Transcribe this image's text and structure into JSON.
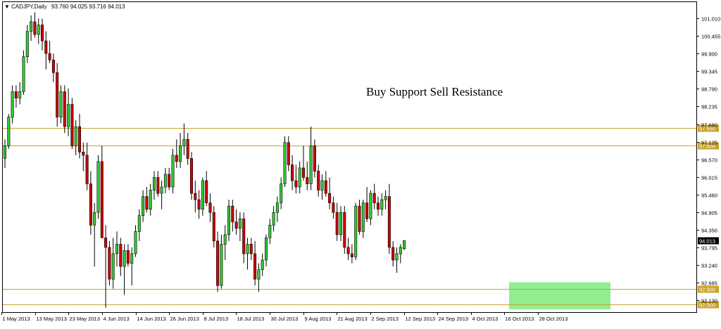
{
  "header": {
    "arrow_icon": "triangle-down-icon",
    "symbol": "CADJPY,Daily",
    "ohlc": "93.760 94.025 93.716 94.013"
  },
  "chart_data": {
    "type": "candlestick",
    "symbol": "CADJPY,Daily",
    "annotation": "Buy Support Sell Resistance",
    "ylim": [
      91.7,
      101.4
    ],
    "y_ticks": [
      "101.010",
      "100.455",
      "99.900",
      "99.345",
      "98.790",
      "98.235",
      "97.680",
      "97.125",
      "96.570",
      "96.015",
      "95.460",
      "94.905",
      "94.350",
      "93.795",
      "93.240",
      "92.685",
      "92.130"
    ],
    "x_ticks": [
      "1 May 2013",
      "13 May 2013",
      "23 May 2013",
      "4 Jun 2013",
      "14 Jun 2013",
      "26 Jun 2013",
      "8 Jul 2013",
      "18 Jul 2013",
      "30 Jul 2013",
      "9 Aug 2013",
      "21 Aug 2013",
      "2 Sep 2013",
      "12 Sep 2013",
      "24 Sep 2013",
      "4 Oct 2013",
      "16 Oct 2013",
      "28 Oct 2013"
    ],
    "current_price": "94.013",
    "horizontal_lines": [
      {
        "label": "97.550",
        "value": 97.55
      },
      {
        "label": "97.000",
        "value": 97.0
      },
      {
        "label": "92.500",
        "value": 92.5
      },
      {
        "label": "92.000",
        "value": 92.0
      }
    ],
    "zone": {
      "price_low": 91.85,
      "price_high": 92.7,
      "color": "#90ee90",
      "start_date": "15 Oct 2013",
      "end_date": "Nov 2013"
    },
    "colors": {
      "up": "#33cc33",
      "down": "#cc0000",
      "wick": "#000000",
      "level_line": "#c9a227",
      "grid_label": "#000000"
    },
    "candles": [
      {
        "o": 96.6,
        "h": 97.2,
        "l": 96.3,
        "c": 97.0
      },
      {
        "o": 97.0,
        "h": 98.0,
        "l": 96.9,
        "c": 97.9
      },
      {
        "o": 97.9,
        "h": 98.9,
        "l": 97.7,
        "c": 98.7
      },
      {
        "o": 98.7,
        "h": 98.9,
        "l": 98.2,
        "c": 98.5
      },
      {
        "o": 98.5,
        "h": 99.0,
        "l": 98.3,
        "c": 98.7
      },
      {
        "o": 98.7,
        "h": 100.0,
        "l": 98.6,
        "c": 99.8
      },
      {
        "o": 99.8,
        "h": 100.8,
        "l": 99.6,
        "c": 100.6
      },
      {
        "o": 100.6,
        "h": 101.1,
        "l": 100.3,
        "c": 100.9
      },
      {
        "o": 100.9,
        "h": 101.2,
        "l": 100.4,
        "c": 100.5
      },
      {
        "o": 100.5,
        "h": 101.0,
        "l": 100.2,
        "c": 100.8
      },
      {
        "o": 100.8,
        "h": 101.0,
        "l": 100.0,
        "c": 100.3
      },
      {
        "o": 100.3,
        "h": 100.6,
        "l": 99.4,
        "c": 99.9
      },
      {
        "o": 99.9,
        "h": 100.3,
        "l": 99.6,
        "c": 99.7
      },
      {
        "o": 99.7,
        "h": 99.9,
        "l": 99.0,
        "c": 99.3
      },
      {
        "o": 99.3,
        "h": 99.6,
        "l": 97.6,
        "c": 97.9
      },
      {
        "o": 97.9,
        "h": 98.9,
        "l": 97.7,
        "c": 98.7
      },
      {
        "o": 98.7,
        "h": 98.9,
        "l": 97.4,
        "c": 97.6
      },
      {
        "o": 97.6,
        "h": 98.8,
        "l": 97.3,
        "c": 98.3
      },
      {
        "o": 98.3,
        "h": 98.5,
        "l": 96.9,
        "c": 97.0
      },
      {
        "o": 97.0,
        "h": 97.8,
        "l": 96.7,
        "c": 97.6
      },
      {
        "o": 97.6,
        "h": 98.0,
        "l": 96.6,
        "c": 96.8
      },
      {
        "o": 96.8,
        "h": 97.1,
        "l": 96.2,
        "c": 96.7
      },
      {
        "o": 96.7,
        "h": 97.1,
        "l": 95.6,
        "c": 95.8
      },
      {
        "o": 95.8,
        "h": 96.2,
        "l": 94.2,
        "c": 94.5
      },
      {
        "o": 94.5,
        "h": 95.2,
        "l": 93.2,
        "c": 94.9
      },
      {
        "o": 94.9,
        "h": 96.7,
        "l": 94.7,
        "c": 96.5
      },
      {
        "o": 96.5,
        "h": 97.0,
        "l": 95.0,
        "c": 94.1
      },
      {
        "o": 94.1,
        "h": 94.5,
        "l": 91.9,
        "c": 93.8
      },
      {
        "o": 93.8,
        "h": 94.0,
        "l": 92.6,
        "c": 92.8
      },
      {
        "o": 92.8,
        "h": 94.1,
        "l": 92.5,
        "c": 93.6
      },
      {
        "o": 93.6,
        "h": 94.3,
        "l": 93.2,
        "c": 93.9
      },
      {
        "o": 93.9,
        "h": 94.1,
        "l": 92.9,
        "c": 93.2
      },
      {
        "o": 93.2,
        "h": 93.9,
        "l": 92.3,
        "c": 93.7
      },
      {
        "o": 93.7,
        "h": 93.9,
        "l": 93.2,
        "c": 93.3
      },
      {
        "o": 93.3,
        "h": 93.8,
        "l": 92.6,
        "c": 93.6
      },
      {
        "o": 93.6,
        "h": 94.5,
        "l": 93.5,
        "c": 94.3
      },
      {
        "o": 94.3,
        "h": 95.0,
        "l": 94.0,
        "c": 94.8
      },
      {
        "o": 94.8,
        "h": 95.6,
        "l": 94.6,
        "c": 95.4
      },
      {
        "o": 95.4,
        "h": 95.7,
        "l": 94.9,
        "c": 95.0
      },
      {
        "o": 95.0,
        "h": 95.8,
        "l": 94.8,
        "c": 95.6
      },
      {
        "o": 95.6,
        "h": 96.2,
        "l": 95.3,
        "c": 96.0
      },
      {
        "o": 96.0,
        "h": 96.2,
        "l": 95.4,
        "c": 95.5
      },
      {
        "o": 95.5,
        "h": 95.9,
        "l": 95.0,
        "c": 95.7
      },
      {
        "o": 95.7,
        "h": 96.3,
        "l": 95.5,
        "c": 96.1
      },
      {
        "o": 96.1,
        "h": 96.3,
        "l": 95.6,
        "c": 95.7
      },
      {
        "o": 95.7,
        "h": 96.9,
        "l": 95.5,
        "c": 96.7
      },
      {
        "o": 96.7,
        "h": 97.2,
        "l": 96.3,
        "c": 96.5
      },
      {
        "o": 96.5,
        "h": 97.4,
        "l": 96.3,
        "c": 97.0
      },
      {
        "o": 97.0,
        "h": 97.7,
        "l": 96.7,
        "c": 97.2
      },
      {
        "o": 97.2,
        "h": 97.4,
        "l": 96.4,
        "c": 96.6
      },
      {
        "o": 96.6,
        "h": 96.8,
        "l": 95.3,
        "c": 95.5
      },
      {
        "o": 95.5,
        "h": 95.9,
        "l": 94.9,
        "c": 95.3
      },
      {
        "o": 95.3,
        "h": 95.6,
        "l": 94.7,
        "c": 95.0
      },
      {
        "o": 95.0,
        "h": 96.0,
        "l": 94.8,
        "c": 95.9
      },
      {
        "o": 95.9,
        "h": 96.2,
        "l": 95.1,
        "c": 95.2
      },
      {
        "o": 95.2,
        "h": 95.5,
        "l": 94.6,
        "c": 94.9
      },
      {
        "o": 94.9,
        "h": 95.1,
        "l": 93.8,
        "c": 94.0
      },
      {
        "o": 94.0,
        "h": 94.3,
        "l": 92.4,
        "c": 92.6
      },
      {
        "o": 92.6,
        "h": 94.2,
        "l": 92.5,
        "c": 93.9
      },
      {
        "o": 93.9,
        "h": 94.5,
        "l": 93.4,
        "c": 94.2
      },
      {
        "o": 94.2,
        "h": 95.3,
        "l": 94.0,
        "c": 95.1
      },
      {
        "o": 95.1,
        "h": 95.3,
        "l": 94.3,
        "c": 94.6
      },
      {
        "o": 94.6,
        "h": 95.0,
        "l": 94.2,
        "c": 94.4
      },
      {
        "o": 94.4,
        "h": 94.9,
        "l": 94.0,
        "c": 94.7
      },
      {
        "o": 94.7,
        "h": 94.9,
        "l": 93.3,
        "c": 93.6
      },
      {
        "o": 93.6,
        "h": 94.1,
        "l": 93.1,
        "c": 93.9
      },
      {
        "o": 93.9,
        "h": 94.1,
        "l": 93.4,
        "c": 93.6
      },
      {
        "o": 93.6,
        "h": 94.0,
        "l": 92.6,
        "c": 92.8
      },
      {
        "o": 92.8,
        "h": 93.3,
        "l": 92.4,
        "c": 93.1
      },
      {
        "o": 93.1,
        "h": 93.6,
        "l": 92.9,
        "c": 93.4
      },
      {
        "o": 93.4,
        "h": 94.2,
        "l": 93.2,
        "c": 94.1
      },
      {
        "o": 94.1,
        "h": 94.7,
        "l": 93.9,
        "c": 94.5
      },
      {
        "o": 94.5,
        "h": 95.1,
        "l": 94.3,
        "c": 94.9
      },
      {
        "o": 94.9,
        "h": 95.4,
        "l": 94.6,
        "c": 95.2
      },
      {
        "o": 95.2,
        "h": 96.0,
        "l": 95.0,
        "c": 95.8
      },
      {
        "o": 95.8,
        "h": 97.3,
        "l": 95.7,
        "c": 97.1
      },
      {
        "o": 97.1,
        "h": 97.3,
        "l": 96.2,
        "c": 96.4
      },
      {
        "o": 96.4,
        "h": 96.7,
        "l": 95.6,
        "c": 95.9
      },
      {
        "o": 95.9,
        "h": 96.4,
        "l": 95.5,
        "c": 95.7
      },
      {
        "o": 95.7,
        "h": 96.5,
        "l": 95.5,
        "c": 96.3
      },
      {
        "o": 96.3,
        "h": 97.0,
        "l": 95.9,
        "c": 96.0
      },
      {
        "o": 96.0,
        "h": 96.5,
        "l": 95.6,
        "c": 95.8
      },
      {
        "o": 95.8,
        "h": 97.6,
        "l": 95.6,
        "c": 97.0
      },
      {
        "o": 97.0,
        "h": 97.2,
        "l": 96.0,
        "c": 96.2
      },
      {
        "o": 96.2,
        "h": 96.4,
        "l": 95.4,
        "c": 95.6
      },
      {
        "o": 95.6,
        "h": 96.1,
        "l": 95.3,
        "c": 95.9
      },
      {
        "o": 95.9,
        "h": 96.2,
        "l": 95.4,
        "c": 95.5
      },
      {
        "o": 95.5,
        "h": 96.0,
        "l": 95.0,
        "c": 95.2
      },
      {
        "o": 95.2,
        "h": 95.4,
        "l": 94.7,
        "c": 94.9
      },
      {
        "o": 94.9,
        "h": 95.2,
        "l": 94.0,
        "c": 94.2
      },
      {
        "o": 94.2,
        "h": 95.1,
        "l": 94.0,
        "c": 94.9
      },
      {
        "o": 94.9,
        "h": 95.1,
        "l": 93.6,
        "c": 93.8
      },
      {
        "o": 93.8,
        "h": 94.1,
        "l": 93.4,
        "c": 93.6
      },
      {
        "o": 93.6,
        "h": 93.9,
        "l": 93.3,
        "c": 93.5
      },
      {
        "o": 93.5,
        "h": 95.2,
        "l": 93.4,
        "c": 95.1
      },
      {
        "o": 95.1,
        "h": 95.3,
        "l": 94.2,
        "c": 94.3
      },
      {
        "o": 94.3,
        "h": 95.3,
        "l": 94.1,
        "c": 95.2
      },
      {
        "o": 95.2,
        "h": 95.7,
        "l": 94.6,
        "c": 94.7
      },
      {
        "o": 94.7,
        "h": 95.6,
        "l": 94.5,
        "c": 95.5
      },
      {
        "o": 95.5,
        "h": 95.8,
        "l": 95.0,
        "c": 95.2
      },
      {
        "o": 95.2,
        "h": 95.4,
        "l": 94.8,
        "c": 95.0
      },
      {
        "o": 95.0,
        "h": 95.5,
        "l": 94.8,
        "c": 95.3
      },
      {
        "o": 95.3,
        "h": 95.6,
        "l": 95.0,
        "c": 95.4
      },
      {
        "o": 95.4,
        "h": 95.8,
        "l": 93.6,
        "c": 93.8
      },
      {
        "o": 93.8,
        "h": 94.0,
        "l": 93.2,
        "c": 93.4
      },
      {
        "o": 93.4,
        "h": 93.8,
        "l": 93.0,
        "c": 93.6
      },
      {
        "o": 93.6,
        "h": 93.9,
        "l": 93.3,
        "c": 93.8
      },
      {
        "o": 93.76,
        "h": 94.025,
        "l": 93.716,
        "c": 94.013
      }
    ]
  }
}
